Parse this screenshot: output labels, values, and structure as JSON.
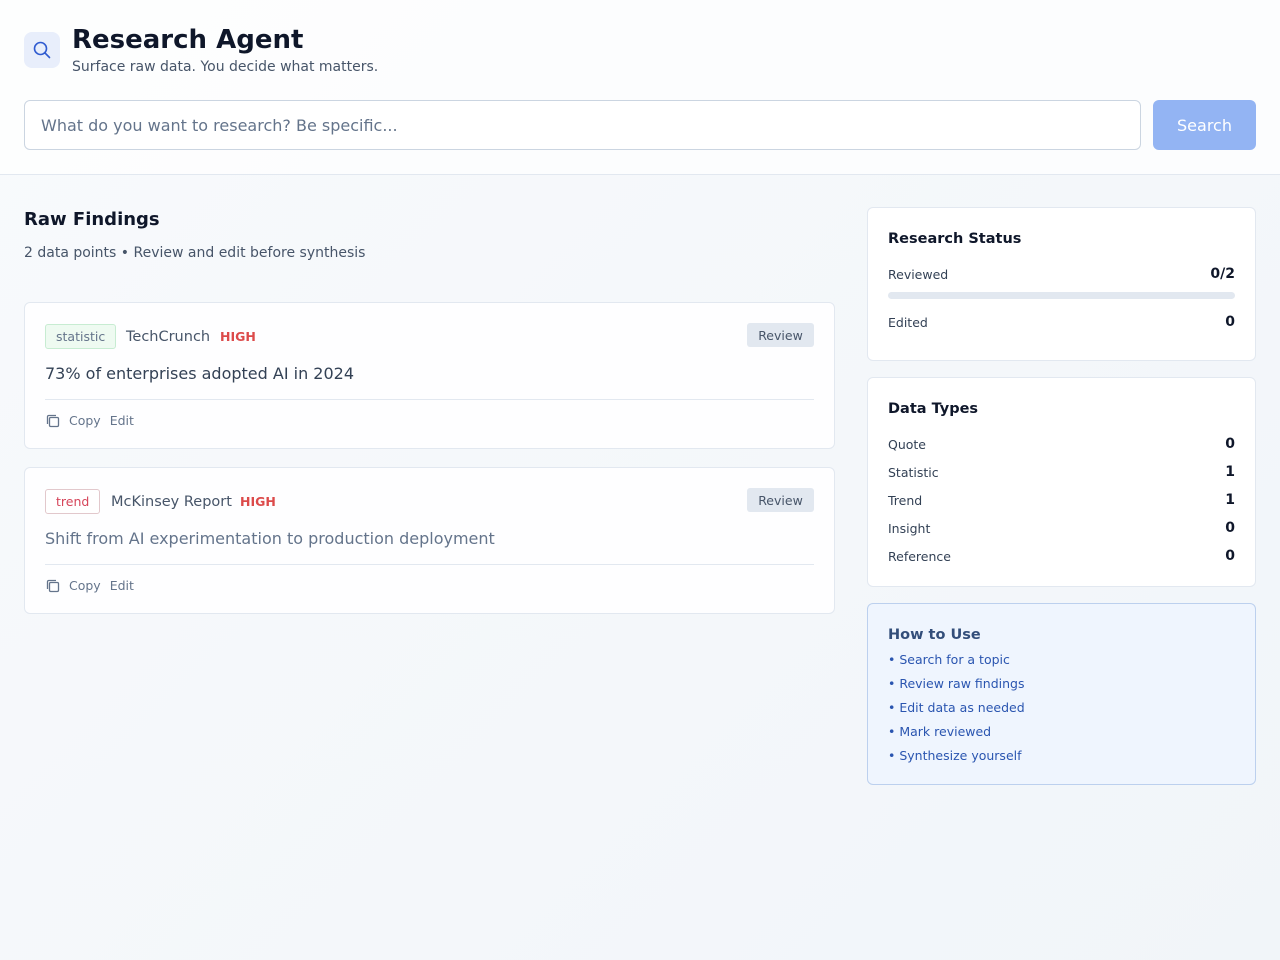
{
  "header": {
    "title": "Research Agent",
    "subtitle": "Surface raw data. You decide what matters.",
    "logo_icon": "search-icon"
  },
  "search": {
    "placeholder": "What do you want to research? Be specific...",
    "value": "",
    "button_label": "Search"
  },
  "findings": {
    "title": "Raw Findings",
    "meta": "2 data points • Review and edit before synthesis",
    "items": [
      {
        "type": "statistic",
        "source": "TechCrunch",
        "priority": "HIGH",
        "text": "73% of enterprises adopted AI in 2024",
        "review_label": "Review",
        "copy_label": "Copy",
        "edit_label": "Edit"
      },
      {
        "type": "trend",
        "source": "McKinsey Report",
        "priority": "HIGH",
        "text": "Shift from AI experimentation to production deployment",
        "review_label": "Review",
        "copy_label": "Copy",
        "edit_label": "Edit"
      }
    ]
  },
  "status": {
    "title": "Research Status",
    "reviewed_label": "Reviewed",
    "reviewed_value": "0/2",
    "reviewed_fraction": 0,
    "edited_label": "Edited",
    "edited_value": "0"
  },
  "data_types": {
    "title": "Data Types",
    "rows": [
      {
        "label": "Quote",
        "value": "0"
      },
      {
        "label": "Statistic",
        "value": "1"
      },
      {
        "label": "Trend",
        "value": "1"
      },
      {
        "label": "Insight",
        "value": "0"
      },
      {
        "label": "Reference",
        "value": "0"
      }
    ]
  },
  "how_to": {
    "title": "How to Use",
    "items": [
      "• Search for a topic",
      "• Review raw findings",
      "• Edit data as needed",
      "• Mark reviewed",
      "• Synthesize yourself"
    ]
  },
  "colors": {
    "accent": "#3b82f6",
    "search_button": "#93b4f3",
    "priority_high": "#dc4a4a",
    "how_to_background": "#eff5fe"
  }
}
